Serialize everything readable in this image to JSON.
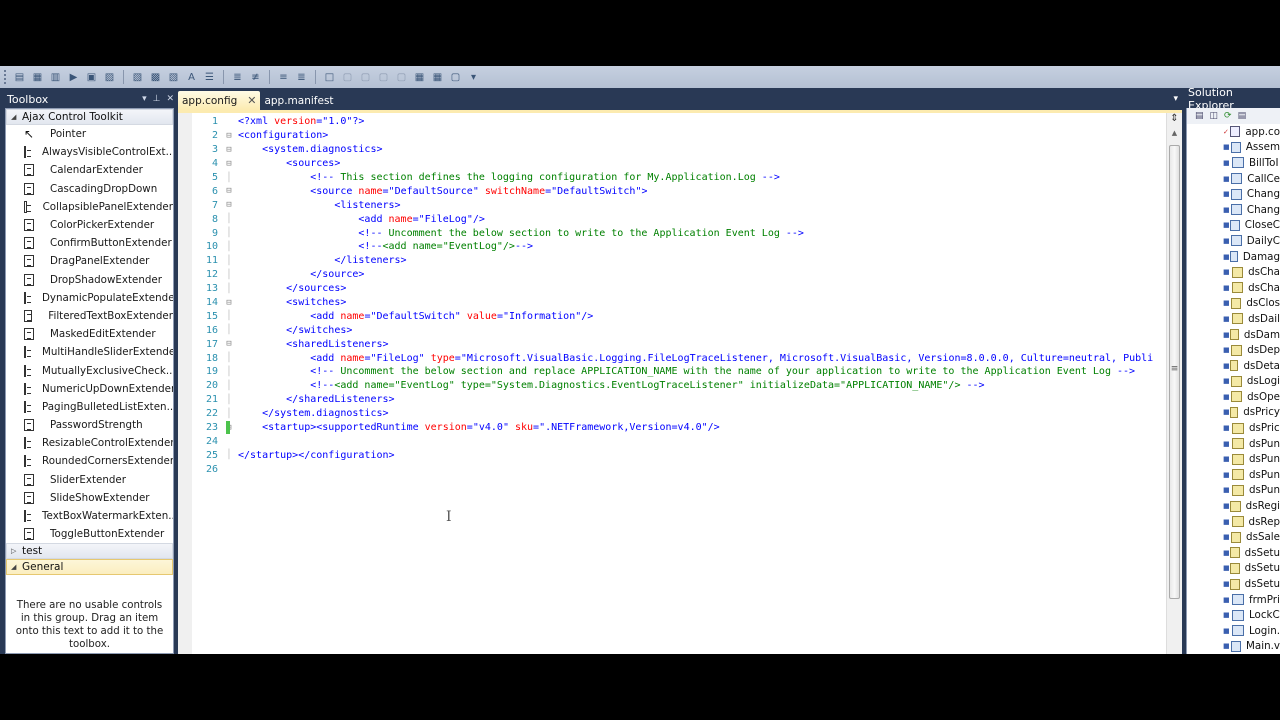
{
  "toolbar": {
    "icons": [
      "new-project-icon",
      "add-item-icon",
      "properties-icon",
      "start-icon",
      "open-file-icon",
      "save-icon",
      "find-icon",
      "replace-icon",
      "navigate-icon",
      "font-icon",
      "indent-icon",
      "decrease-indent-icon",
      "increase-indent-icon",
      "comment-icon",
      "uncomment-icon",
      "bookmark-icon",
      "prev-bookmark-icon",
      "next-bookmark-icon",
      "prev-bookmark-folder-icon",
      "next-bookmark-folder-icon",
      "clear-bookmarks-icon",
      "toggle-icon",
      "overflow-icon"
    ]
  },
  "toolbox": {
    "title": "Toolbox",
    "pin_glyph": "▾",
    "autohide_glyph": "⊥",
    "close_glyph": "✕",
    "groups": [
      {
        "label": "Ajax Control Toolkit",
        "expanded": true,
        "items": [
          "Pointer",
          "AlwaysVisibleControlExt...",
          "CalendarExtender",
          "CascadingDropDown",
          "CollapsiblePanelExtender",
          "ColorPickerExtender",
          "ConfirmButtonExtender",
          "DragPanelExtender",
          "DropShadowExtender",
          "DynamicPopulateExtender",
          "FilteredTextBoxExtender",
          "MaskedEditExtender",
          "MultiHandleSliderExtender",
          "MutuallyExclusiveCheck...",
          "NumericUpDownExtender",
          "PagingBulletedListExten...",
          "PasswordStrength",
          "ResizableControlExtender",
          "RoundedCornersExtender",
          "SliderExtender",
          "SlideShowExtender",
          "TextBoxWatermarkExten...",
          "ToggleButtonExtender"
        ]
      },
      {
        "label": "test",
        "expanded": false
      },
      {
        "label": "General",
        "expanded": true,
        "selected": true
      }
    ],
    "empty_message": "There are no usable controls in this group. Drag an item onto this text to add it to the toolbox."
  },
  "editor": {
    "tabs": [
      {
        "label": "app.config",
        "active": true,
        "close_glyph": "✕"
      },
      {
        "label": "app.manifest",
        "active": false
      }
    ],
    "dropdown_glyph": "▾",
    "lines": [
      {
        "n": "1",
        "fold": "",
        "segs": [
          [
            "t",
            "<?xml "
          ],
          [
            "a",
            "version"
          ],
          [
            "t",
            "=\""
          ],
          [
            "v",
            "1.0"
          ],
          [
            "t",
            "\"?>"
          ]
        ]
      },
      {
        "n": "2",
        "fold": "⊟",
        "segs": [
          [
            "t",
            "<configuration>"
          ]
        ]
      },
      {
        "n": "3",
        "fold": "⊟",
        "segs": [
          [
            "t",
            "    <system.diagnostics>"
          ]
        ]
      },
      {
        "n": "4",
        "fold": "⊟",
        "segs": [
          [
            "t",
            "        <sources>"
          ]
        ]
      },
      {
        "n": "5",
        "fold": "",
        "segs": [
          [
            "t",
            "            <!--"
          ],
          [
            "c",
            " This section defines the logging configuration for My.Application.Log "
          ],
          [
            "t",
            "-->"
          ]
        ]
      },
      {
        "n": "6",
        "fold": "⊟",
        "segs": [
          [
            "t",
            "            <source "
          ],
          [
            "a",
            "name"
          ],
          [
            "t",
            "=\""
          ],
          [
            "v",
            "DefaultSource"
          ],
          [
            "t",
            "\" "
          ],
          [
            "a",
            "switchName"
          ],
          [
            "t",
            "=\""
          ],
          [
            "v",
            "DefaultSwitch"
          ],
          [
            "t",
            "\">"
          ]
        ]
      },
      {
        "n": "7",
        "fold": "⊟",
        "segs": [
          [
            "t",
            "                <listeners>"
          ]
        ]
      },
      {
        "n": "8",
        "fold": "",
        "segs": [
          [
            "t",
            "                    <add "
          ],
          [
            "a",
            "name"
          ],
          [
            "t",
            "=\""
          ],
          [
            "v",
            "FileLog"
          ],
          [
            "t",
            "\"/>"
          ]
        ]
      },
      {
        "n": "9",
        "fold": "",
        "segs": [
          [
            "t",
            "                    <!--"
          ],
          [
            "c",
            " Uncomment the below section to write to the Application Event Log "
          ],
          [
            "t",
            "-->"
          ]
        ]
      },
      {
        "n": "10",
        "fold": "",
        "segs": [
          [
            "t",
            "                    <!--"
          ],
          [
            "c",
            "<add name=\"EventLog\"/>"
          ],
          [
            "t",
            "-->"
          ]
        ]
      },
      {
        "n": "11",
        "fold": "",
        "segs": [
          [
            "t",
            "                </listeners>"
          ]
        ]
      },
      {
        "n": "12",
        "fold": "",
        "segs": [
          [
            "t",
            "            </source>"
          ]
        ]
      },
      {
        "n": "13",
        "fold": "",
        "segs": [
          [
            "t",
            "        </sources>"
          ]
        ]
      },
      {
        "n": "14",
        "fold": "⊟",
        "segs": [
          [
            "t",
            "        <switches>"
          ]
        ]
      },
      {
        "n": "15",
        "fold": "",
        "segs": [
          [
            "t",
            "            <add "
          ],
          [
            "a",
            "name"
          ],
          [
            "t",
            "=\""
          ],
          [
            "v",
            "DefaultSwitch"
          ],
          [
            "t",
            "\" "
          ],
          [
            "a",
            "value"
          ],
          [
            "t",
            "=\""
          ],
          [
            "v",
            "Information"
          ],
          [
            "t",
            "\"/>"
          ]
        ]
      },
      {
        "n": "16",
        "fold": "",
        "segs": [
          [
            "t",
            "        </switches>"
          ]
        ]
      },
      {
        "n": "17",
        "fold": "⊟",
        "segs": [
          [
            "t",
            "        <sharedListeners>"
          ]
        ]
      },
      {
        "n": "18",
        "fold": "",
        "segs": [
          [
            "t",
            "            <add "
          ],
          [
            "a",
            "name"
          ],
          [
            "t",
            "=\""
          ],
          [
            "v",
            "FileLog"
          ],
          [
            "t",
            "\" "
          ],
          [
            "a",
            "type"
          ],
          [
            "t",
            "=\""
          ],
          [
            "v",
            "Microsoft.VisualBasic.Logging.FileLogTraceListener, Microsoft.VisualBasic, Version=8.0.0.0, Culture=neutral, Publi"
          ]
        ]
      },
      {
        "n": "19",
        "fold": "",
        "segs": [
          [
            "t",
            "            <!--"
          ],
          [
            "c",
            " Uncomment the below section and replace APPLICATION_NAME with the name of your application to write to the Application Event Log "
          ],
          [
            "t",
            "-->"
          ]
        ]
      },
      {
        "n": "20",
        "fold": "",
        "segs": [
          [
            "t",
            "            <!--"
          ],
          [
            "c",
            "<add name=\"EventLog\" type=\"System.Diagnostics.EventLogTraceListener\" initializeData=\"APPLICATION_NAME\"/> "
          ],
          [
            "t",
            "-->"
          ]
        ]
      },
      {
        "n": "21",
        "fold": "",
        "segs": [
          [
            "t",
            "        </sharedListeners>"
          ]
        ]
      },
      {
        "n": "22",
        "fold": "",
        "segs": [
          [
            "t",
            "    </system.diagnostics>"
          ]
        ]
      },
      {
        "n": "23",
        "fold": "⊟",
        "changed": true,
        "segs": [
          [
            "t",
            "    <startup><supportedRuntime "
          ],
          [
            "a",
            "version"
          ],
          [
            "t",
            "=\""
          ],
          [
            "v",
            "v4.0"
          ],
          [
            "t",
            "\" "
          ],
          [
            "a",
            "sku"
          ],
          [
            "t",
            "=\""
          ],
          [
            "v",
            ".NETFramework,Version=v4.0"
          ],
          [
            "t",
            "\"/>"
          ]
        ]
      },
      {
        "n": "24",
        "fold": "",
        "segs": []
      },
      {
        "n": "25",
        "fold": "",
        "segs": [
          [
            "t",
            "</startup></configuration>"
          ]
        ]
      },
      {
        "n": "26",
        "fold": "",
        "segs": []
      }
    ],
    "scroll_position": 0.0
  },
  "solution_explorer": {
    "title": "Solution Explorer",
    "items": [
      {
        "label": "app.co",
        "kind": "cfg",
        "status": "checked"
      },
      {
        "label": "Assem",
        "kind": "form",
        "status": "locked"
      },
      {
        "label": "BillToI",
        "kind": "form",
        "status": "locked"
      },
      {
        "label": "CallCe",
        "kind": "form",
        "status": "locked"
      },
      {
        "label": "Chang",
        "kind": "form",
        "status": "locked"
      },
      {
        "label": "Chang",
        "kind": "form",
        "status": "locked"
      },
      {
        "label": "CloseC",
        "kind": "form",
        "status": "locked"
      },
      {
        "label": "DailyC",
        "kind": "form",
        "status": "locked"
      },
      {
        "label": "Damag",
        "kind": "form",
        "status": "locked"
      },
      {
        "label": "dsCha",
        "kind": "ds",
        "status": "locked"
      },
      {
        "label": "dsCha",
        "kind": "ds",
        "status": "locked"
      },
      {
        "label": "dsClos",
        "kind": "ds",
        "status": "locked"
      },
      {
        "label": "dsDail",
        "kind": "ds",
        "status": "locked"
      },
      {
        "label": "dsDam",
        "kind": "ds",
        "status": "locked"
      },
      {
        "label": "dsDep",
        "kind": "ds",
        "status": "locked"
      },
      {
        "label": "dsDeta",
        "kind": "ds",
        "status": "locked"
      },
      {
        "label": "dsLogi",
        "kind": "ds",
        "status": "locked"
      },
      {
        "label": "dsOpe",
        "kind": "ds",
        "status": "locked"
      },
      {
        "label": "dsPricy",
        "kind": "ds",
        "status": "locked"
      },
      {
        "label": "dsPric",
        "kind": "ds",
        "status": "locked"
      },
      {
        "label": "dsPun",
        "kind": "ds",
        "status": "locked"
      },
      {
        "label": "dsPun",
        "kind": "ds",
        "status": "locked"
      },
      {
        "label": "dsPun",
        "kind": "ds",
        "status": "locked"
      },
      {
        "label": "dsPun",
        "kind": "ds",
        "status": "locked"
      },
      {
        "label": "dsRegi",
        "kind": "ds",
        "status": "locked"
      },
      {
        "label": "dsRep",
        "kind": "ds",
        "status": "locked"
      },
      {
        "label": "dsSale",
        "kind": "ds",
        "status": "locked"
      },
      {
        "label": "dsSetu",
        "kind": "ds",
        "status": "locked"
      },
      {
        "label": "dsSetu",
        "kind": "ds",
        "status": "locked"
      },
      {
        "label": "dsSetu",
        "kind": "ds",
        "status": "locked"
      },
      {
        "label": "frmPri",
        "kind": "form",
        "status": "locked"
      },
      {
        "label": "LockC",
        "kind": "form",
        "status": "locked"
      },
      {
        "label": "Login.",
        "kind": "form",
        "status": "locked"
      },
      {
        "label": "Main.v",
        "kind": "form",
        "status": "locked"
      }
    ]
  },
  "colors": {
    "chrome": "#293955",
    "tag": "#0000ff",
    "attribute": "#ff0000",
    "attr_value": "#0000ff",
    "comment": "#008000",
    "line_number": "#2b91af",
    "active_tab": "#fcebb0",
    "change_marker": "#4cc34c"
  }
}
